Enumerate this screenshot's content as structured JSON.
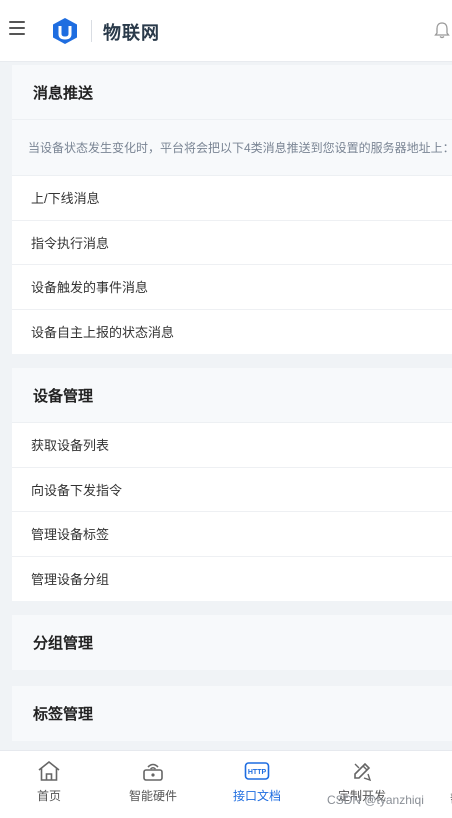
{
  "header": {
    "title": "物联网"
  },
  "sections": [
    {
      "title": "消息推送",
      "description": "当设备状态发生变化时，平台将会把以下4类消息推送到您设置的服务器地址上：",
      "items": [
        "上/下线消息",
        "指令执行消息",
        "设备触发的事件消息",
        "设备自主上报的状态消息"
      ]
    },
    {
      "title": "设备管理",
      "items": [
        "获取设备列表",
        "向设备下发指令",
        "管理设备标签",
        "管理设备分组"
      ]
    },
    {
      "title": "分组管理"
    },
    {
      "title": "标签管理"
    }
  ],
  "tabbar": {
    "tabs": [
      {
        "label": "首页",
        "icon": "home-icon"
      },
      {
        "label": "智能硬件",
        "icon": "router-icon"
      },
      {
        "label": "接口文档",
        "icon": "http-icon",
        "active": true
      },
      {
        "label": "定制开发",
        "icon": "pencil-ruler-icon"
      },
      {
        "label": "帮"
      }
    ],
    "active_color": "#1e6de0",
    "http_icon_text": "HTTP"
  },
  "watermark": "CSDN @tyanzhiqi"
}
